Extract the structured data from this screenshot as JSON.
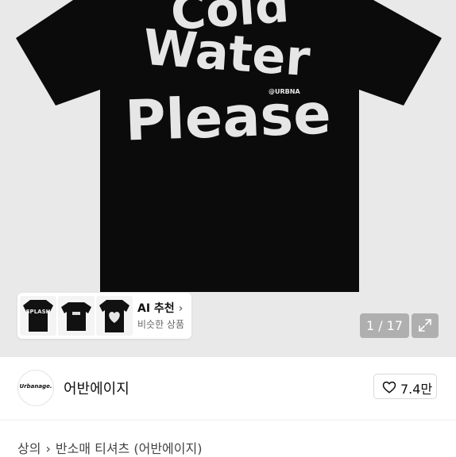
{
  "product_gallery": {
    "graphic_text": [
      "Cold",
      "Water",
      "Please"
    ],
    "graphic_brand_mark": "@URBNA",
    "counter": "1 / 17",
    "expand_icon": "expand-icon"
  },
  "ai_recommend": {
    "title": "AI 추천",
    "arrow": "›",
    "subtitle": "비슷한 상품",
    "thumbnails": [
      "SPLASH",
      "",
      ""
    ]
  },
  "store": {
    "logo_text": "Urbanage.",
    "name": "어반에이지",
    "like_icon": "heart-icon",
    "like_count": "7.4만"
  },
  "breadcrumb": {
    "items": [
      "상의",
      "반소매 티셔츠 (어반에이지)"
    ],
    "separator": "›"
  },
  "colors": {
    "hero_background": "#e9e9ea",
    "shirt": "#0b0b0c",
    "graphic": "#e6e6e6"
  }
}
